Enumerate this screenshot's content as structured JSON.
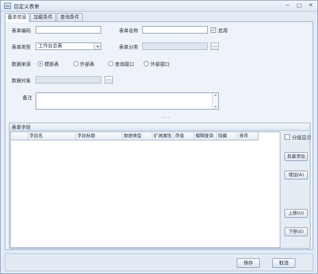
{
  "window": {
    "title": "自定义表单"
  },
  "title_buttons": {
    "minimize": "−",
    "maximize": "□",
    "close": "✕"
  },
  "tabs": [
    {
      "label": "基本信息",
      "active": true
    },
    {
      "label": "加载条件",
      "active": false
    },
    {
      "label": "查询条件",
      "active": false
    }
  ],
  "form": {
    "form_code_label": "表单编码",
    "form_code_value": "",
    "form_name_label": "表单名称",
    "form_name_value": "",
    "enabled_label": "启用",
    "enabled_checked": true,
    "form_type_label": "表单类型",
    "form_type_value": "工作台总表",
    "form_category_label": "表单分类",
    "form_category_value": "",
    "ellipsis": "...",
    "data_source_label": "数据来源",
    "data_source_options": [
      {
        "label": "模板表",
        "selected": true
      },
      {
        "label": "外部表",
        "selected": false
      },
      {
        "label": "查询接口",
        "selected": false
      },
      {
        "label": "外部接口",
        "selected": false
      }
    ],
    "data_object_label": "数据对象",
    "data_object_value": "",
    "remark_label": "备注",
    "remark_value": ""
  },
  "splitter": "....",
  "fields_group": {
    "title": "表单字段",
    "columns": [
      "字段名",
      "字段标题",
      "数据类型",
      "扩展属性",
      "存值",
      "模糊查询",
      "隐藏",
      "排序"
    ],
    "rows": [],
    "group_display_label": "分组显示",
    "group_display_checked": false,
    "buttons": {
      "batch_add": "批量添加",
      "add": "增加(A)",
      "move_up": "上移(U)",
      "move_down": "下移(E)"
    }
  },
  "footer": {
    "save": "保存",
    "cancel": "取消"
  }
}
